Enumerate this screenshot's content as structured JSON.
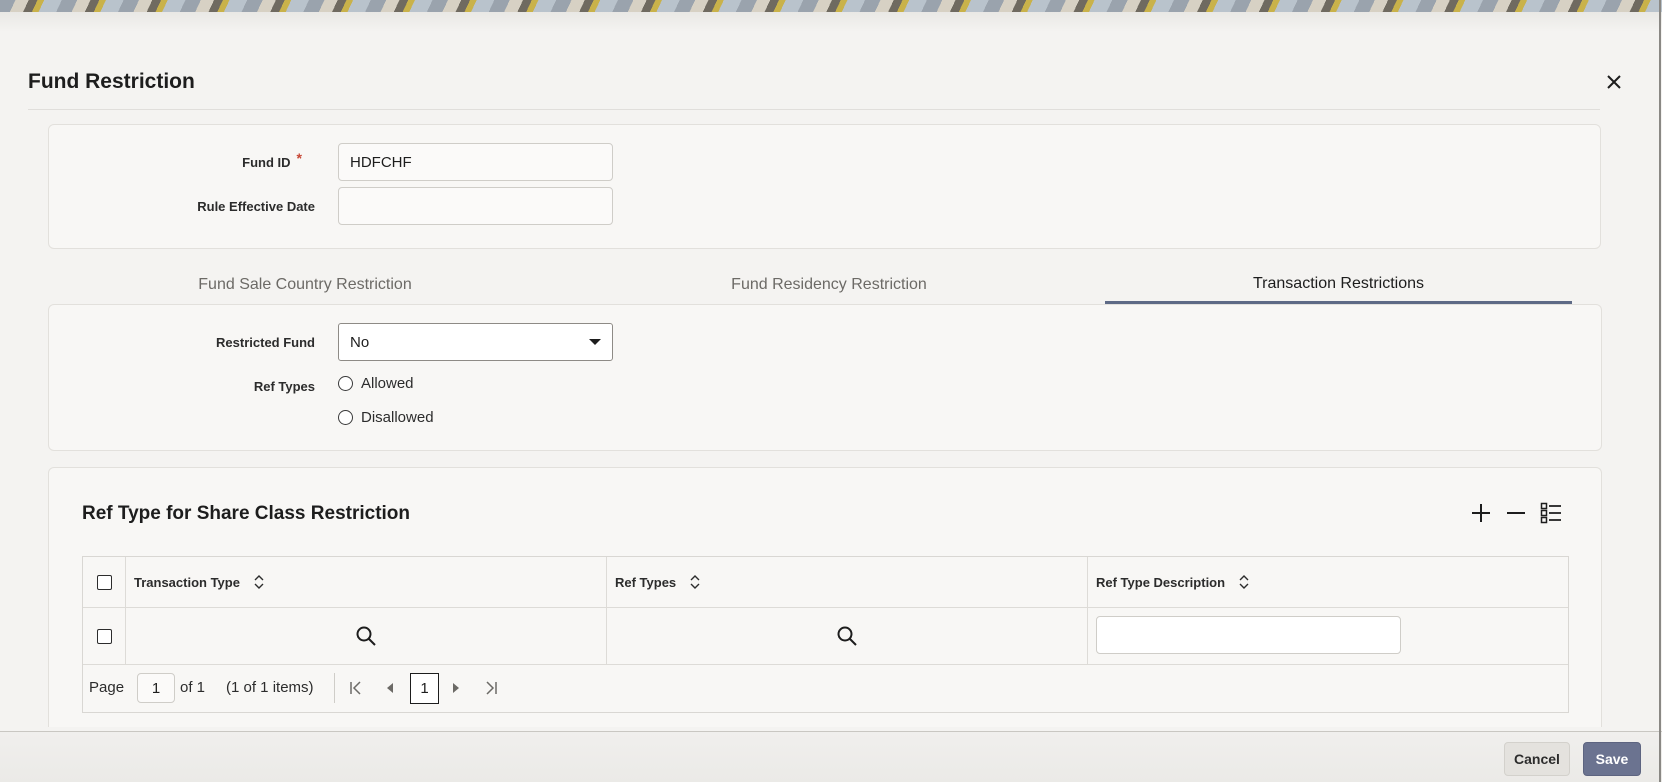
{
  "dialog": {
    "title": "Fund Restriction"
  },
  "form": {
    "fund_id_label": "Fund ID",
    "required_mark": "*",
    "fund_id_value": "HDFCHF",
    "rule_effective_date_label": "Rule Effective Date",
    "rule_effective_date_value": ""
  },
  "tabs": [
    {
      "label": "Fund Sale Country Restriction",
      "active": false
    },
    {
      "label": "Fund Residency Restriction",
      "active": false
    },
    {
      "label": "Transaction Restrictions",
      "active": true
    }
  ],
  "transaction": {
    "restricted_fund_label": "Restricted Fund",
    "restricted_fund_value": "No",
    "ref_types_label": "Ref Types",
    "options": [
      "Allowed",
      "Disallowed"
    ]
  },
  "grid": {
    "title": "Ref Type for Share Class Restriction",
    "columns": [
      "Transaction Type",
      "Ref Types",
      "Ref Type Description"
    ],
    "rows": [
      {
        "transaction_type": "",
        "ref_types": "",
        "ref_type_description": ""
      }
    ],
    "pagination": {
      "page_label": "Page",
      "page_value": "1",
      "of_label": "of 1",
      "items_label": "(1 of 1 items)",
      "current_page": "1"
    }
  },
  "footer": {
    "cancel_label": "Cancel",
    "save_label": "Save"
  },
  "colors": {
    "accent": "#5e6a86",
    "save_button": "#6b7390",
    "required": "#c74634"
  }
}
